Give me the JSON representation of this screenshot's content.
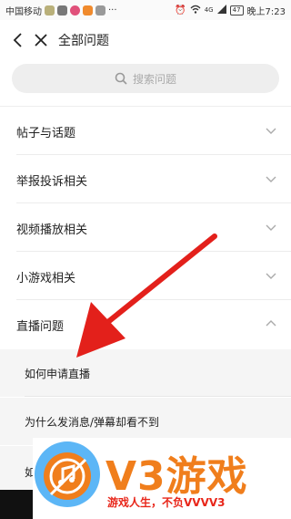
{
  "status_bar": {
    "carrier": "中国移动",
    "signal_text": "4G",
    "battery": "47",
    "time": "晚上7:23"
  },
  "header": {
    "title": "全部问题"
  },
  "search": {
    "placeholder": "搜索问题"
  },
  "categories": [
    {
      "label": "帖子与话题",
      "expanded": false
    },
    {
      "label": "举报投诉相关",
      "expanded": false
    },
    {
      "label": "视频播放相关",
      "expanded": false
    },
    {
      "label": "小游戏相关",
      "expanded": false
    },
    {
      "label": "直播问题",
      "expanded": true
    }
  ],
  "subitems": [
    {
      "label": "如何申请直播"
    },
    {
      "label": "为什么发消息/弹幕却看不到"
    },
    {
      "label": "如"
    }
  ],
  "watermark": {
    "brand": "V3游戏",
    "slogan": "游戏人生，不负VVVV3"
  },
  "colors": {
    "arrow": "#e3201b",
    "brand_orange": "#f07e1c",
    "slogan_red": "#e8261a"
  }
}
